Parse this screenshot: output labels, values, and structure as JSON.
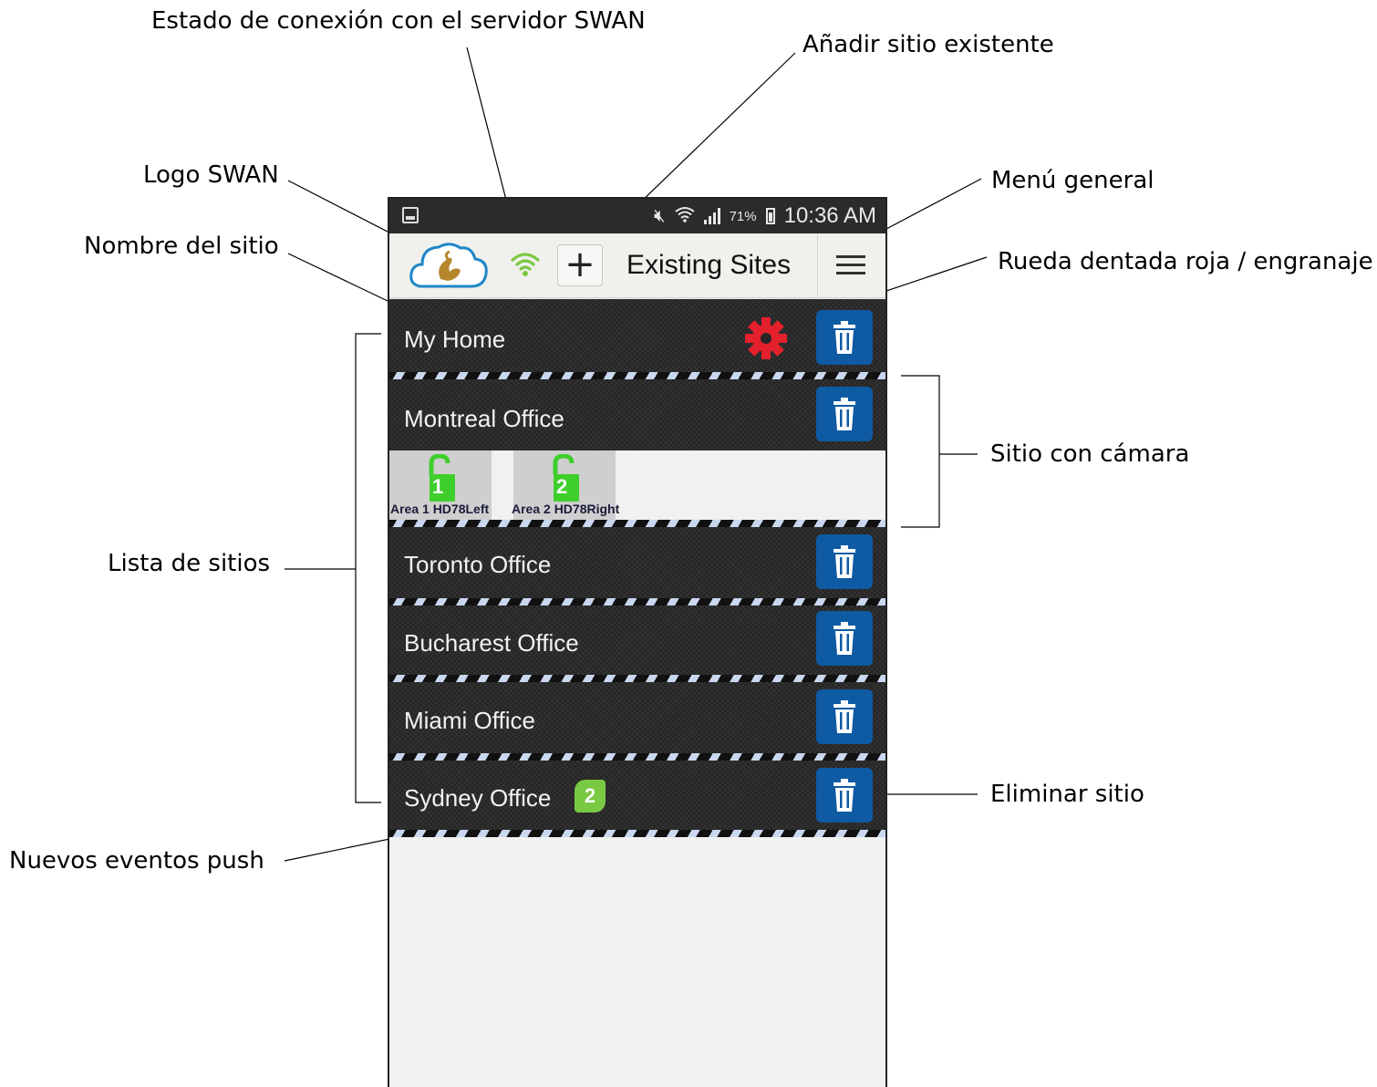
{
  "annotations": {
    "estado_conexion": "Estado de conexión con el servidor SWAN",
    "anadir_sitio": "Añadir sitio existente",
    "logo": "Logo SWAN",
    "menu_general": "Menú general",
    "nombre_sitio": "Nombre del sitio",
    "rueda_dentada": "Rueda dentada roja / engranaje",
    "sitio_camara": "Sitio con cámara",
    "lista_sitios": "Lista de sitios",
    "eliminar_sitio": "Eliminar sitio",
    "nuevos_eventos": "Nuevos eventos push"
  },
  "status_bar": {
    "battery_percent": "71%",
    "time": "10:36 AM",
    "icons": [
      "gallery-icon",
      "mute-icon",
      "wifi-icon",
      "signal-icon",
      "battery-charging-icon"
    ]
  },
  "toolbar": {
    "title": "Existing Sites",
    "add_label": "+",
    "connection_color": "#7ac943"
  },
  "sites": [
    {
      "name": "My Home",
      "has_gear": true
    },
    {
      "name": "Montreal Office",
      "cameras": [
        {
          "number": "1",
          "label": "Area 1 HD78Left"
        },
        {
          "number": "2",
          "label": "Area 2 HD78Right"
        }
      ]
    },
    {
      "name": "Toronto Office"
    },
    {
      "name": "Bucharest Office"
    },
    {
      "name": "Miami Office"
    },
    {
      "name": "Sydney Office",
      "badge": "2"
    }
  ],
  "colors": {
    "row_bg": "#262626",
    "trash_button": "#0e5aa3",
    "gear": "#e3202b",
    "badge": "#7ac943",
    "lock": "#3fcf2c"
  }
}
